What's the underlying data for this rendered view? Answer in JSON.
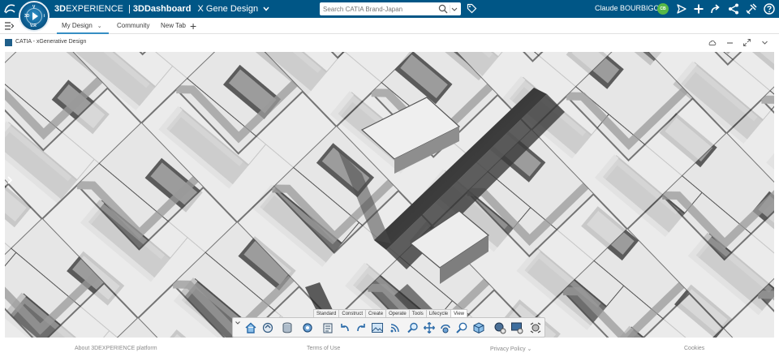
{
  "header": {
    "logo_icon": "ds-logo-icon",
    "compass_icon": "compass-icon",
    "compass_quadrants": [
      "3D",
      "V",
      "V.R",
      "i"
    ],
    "brand_prefix": "3D",
    "brand_product": "EXPERIENCE",
    "brand_sep": "|",
    "brand_app_prefix": "3D",
    "brand_app": "Dashboard",
    "dashboard_name": "X Gene Design",
    "search_placeholder": "Search CATIA Brand-Japan",
    "user_name": "Claude BOURBIGOT",
    "user_initials": "CB",
    "accent_color": "#005686",
    "avatar_color": "#57b847",
    "icons": [
      "tag-icon",
      "share-send-icon",
      "plus-icon",
      "forward-icon",
      "share-icon",
      "tools-icon",
      "help-icon"
    ]
  },
  "tabs": {
    "items": [
      {
        "label": "My Design",
        "active": true
      },
      {
        "label": "Community",
        "active": false
      },
      {
        "label": "New Tab",
        "active": false
      }
    ],
    "active_color": "#368ec4"
  },
  "widget": {
    "title": "CATIA - xGenerative Design",
    "controls": [
      "cloud-icon",
      "minimize-icon",
      "maximize-icon",
      "chevron-down-icon"
    ]
  },
  "action_bar": {
    "tabs": [
      {
        "label": "Standard",
        "active": false
      },
      {
        "label": "Construct",
        "active": false
      },
      {
        "label": "Create",
        "active": false
      },
      {
        "label": "Operate",
        "active": false
      },
      {
        "label": "Tools",
        "active": false
      },
      {
        "label": "Lifecycle",
        "active": false
      },
      {
        "label": "View",
        "active": true
      }
    ],
    "tools": [
      "home-icon",
      "save-icon",
      "database-icon",
      "settings-icon",
      "clipboard-icon",
      "undo-icon",
      "redo-icon",
      "picture-icon",
      "wireless-icon",
      "zoom-icon",
      "pan-icon",
      "rotate-icon",
      "zoom-area-icon",
      "cube-view-icon",
      "capture-icon",
      "render-icon",
      "fly-icon"
    ]
  },
  "footer": {
    "about": "About 3DEXPERIENCE platform",
    "terms": "Terms of Use",
    "privacy": "Privacy Policy",
    "cookies": "Cookies"
  }
}
